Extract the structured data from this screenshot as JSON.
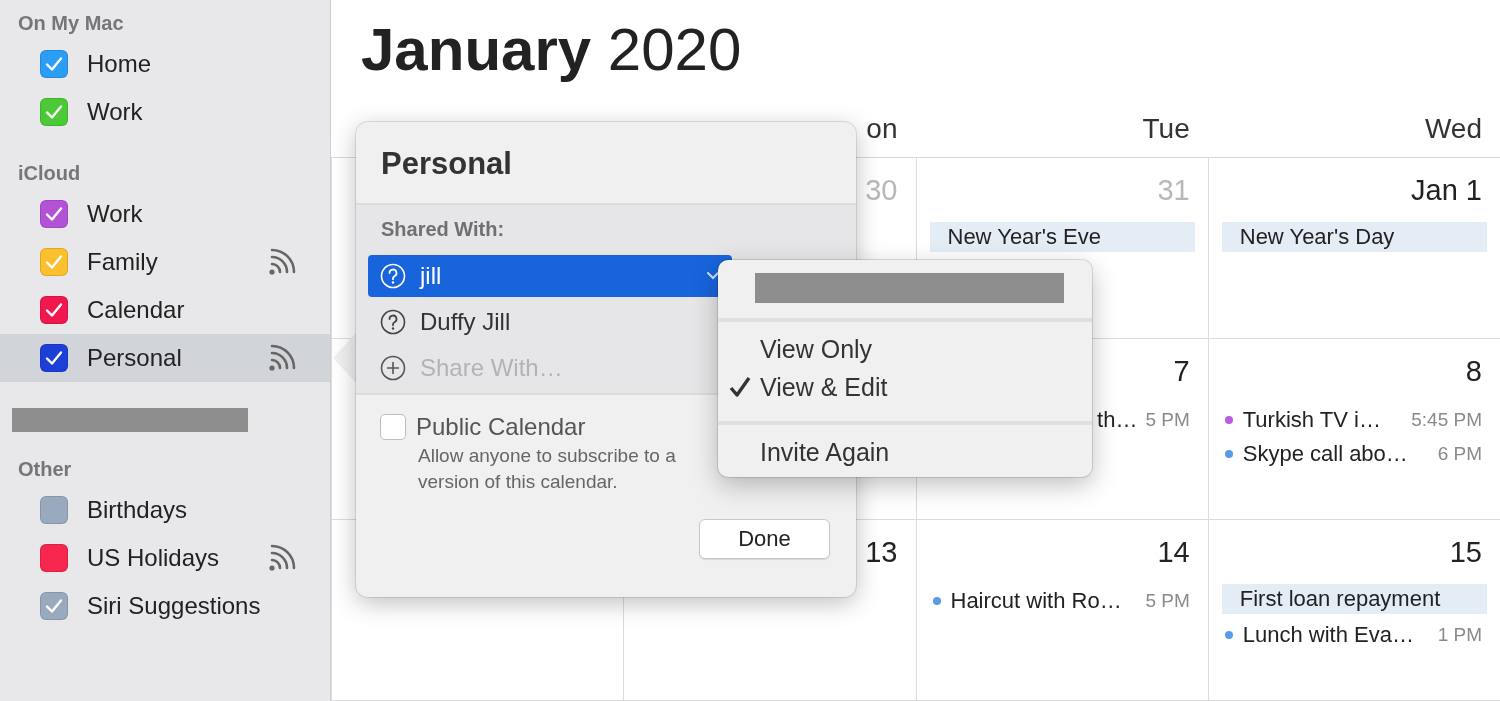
{
  "sidebar": {
    "sections": [
      {
        "kind": "group",
        "title": "On My Mac",
        "items": [
          {
            "label": "Home",
            "color": "#2a9df4",
            "checked": true,
            "shared": false,
            "selected": false
          },
          {
            "label": "Work",
            "color": "#4cc937",
            "checked": true,
            "shared": false,
            "selected": false
          }
        ]
      },
      {
        "kind": "group",
        "title": "iCloud",
        "items": [
          {
            "label": "Work",
            "color": "#b452d6",
            "checked": true,
            "shared": false,
            "selected": false
          },
          {
            "label": "Family",
            "color": "#fcc02e",
            "checked": true,
            "shared": true,
            "selected": false
          },
          {
            "label": "Calendar",
            "color": "#f0184f",
            "checked": true,
            "shared": false,
            "selected": false
          },
          {
            "label": "Personal",
            "color": "#1c3fd6",
            "checked": true,
            "shared": true,
            "selected": true
          }
        ]
      },
      {
        "kind": "redacted"
      },
      {
        "kind": "group",
        "title": "Other",
        "items": [
          {
            "label": "Birthdays",
            "color": "#99aabf",
            "checked": false,
            "shared": false,
            "selected": false
          },
          {
            "label": "US Holidays",
            "color": "#f7264e",
            "checked": false,
            "shared": true,
            "selected": false
          },
          {
            "label": "Siri Suggestions",
            "color": "#99aabf",
            "checked": true,
            "shared": false,
            "selected": false
          }
        ]
      }
    ]
  },
  "calendar": {
    "title": "**January** 2020",
    "weekdays": [
      "on",
      "Tue",
      "Wed"
    ],
    "weeks": [
      [
        {
          "kind": "blank"
        },
        {
          "kind": "day",
          "date": "30",
          "muted": true
        },
        {
          "kind": "day",
          "date": "31",
          "muted": true,
          "events": [
            {
              "kind": "allday",
              "title": "New Year's Eve"
            }
          ]
        },
        {
          "kind": "day",
          "date": "Jan 1",
          "muted": false,
          "events": [
            {
              "kind": "allday",
              "title": "New Year's Day"
            }
          ]
        }
      ],
      [
        {
          "kind": "blank"
        },
        {
          "kind": "blank"
        },
        {
          "kind": "day",
          "date": "7",
          "muted": false,
          "events": [
            {
              "kind": "cut",
              "title": "th…",
              "time": "5 PM"
            }
          ]
        },
        {
          "kind": "day",
          "date": "8",
          "muted": false,
          "events": [
            {
              "kind": "timed",
              "title": "Turkish TV i…",
              "time": "5:45 PM",
              "color": "#b95de0"
            },
            {
              "kind": "timed",
              "title": "Skype call abo…",
              "time": "6 PM",
              "color": "#5a9be8"
            }
          ]
        }
      ],
      [
        {
          "kind": "blank"
        },
        {
          "kind": "day",
          "date": "13",
          "muted": false
        },
        {
          "kind": "day",
          "date": "14",
          "muted": false,
          "events": [
            {
              "kind": "timed",
              "title": "Haircut with Ro…",
              "time": "5 PM",
              "color": "#5a9be8"
            }
          ]
        },
        {
          "kind": "day",
          "date": "15",
          "muted": false,
          "events": [
            {
              "kind": "allday",
              "title": "First loan repayment"
            },
            {
              "kind": "timed",
              "title": "Lunch with Eva…",
              "time": "1 PM",
              "color": "#5a9be8"
            }
          ]
        }
      ]
    ]
  },
  "popover": {
    "title": "Personal",
    "shared_label": "Shared With:",
    "people": [
      {
        "name": "jill",
        "selected": true
      },
      {
        "name": "Duffy Jill",
        "selected": false
      }
    ],
    "share_placeholder": "Share With…",
    "public_calendar": {
      "label": "Public Calendar",
      "checked": false
    },
    "description_lines": [
      "Allow anyone to subscribe to a",
      "version of this calendar."
    ],
    "done": "Done"
  },
  "menu": {
    "items": [
      {
        "kind": "redacted"
      },
      {
        "kind": "separator"
      },
      {
        "kind": "option",
        "label": "View Only",
        "checked": false
      },
      {
        "kind": "option",
        "label": "View & Edit",
        "checked": true
      },
      {
        "kind": "separator"
      },
      {
        "kind": "option",
        "label": "Invite Again",
        "checked": false
      }
    ]
  }
}
